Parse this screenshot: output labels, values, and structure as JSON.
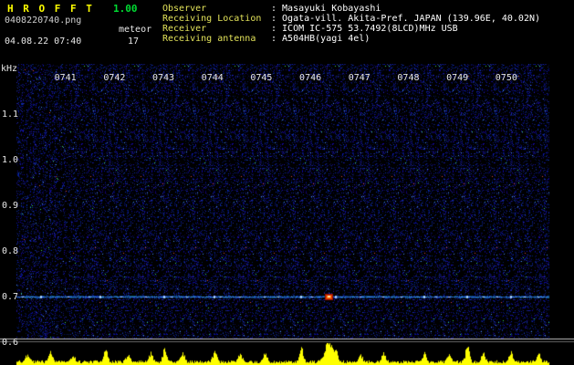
{
  "header": {
    "app_title": "H R O F F T",
    "version": "1.00",
    "filename": "0408220740.png",
    "mode_label": "meteor",
    "date_time": "04.08.22 07:40",
    "echo_count": "17",
    "info_rows": [
      {
        "label": "Observer",
        "value": ": Masayuki Kobayashi"
      },
      {
        "label": "Receiving Location",
        "value": ": Ogata-vill. Akita-Pref. JAPAN (139.96E, 40.02N)"
      },
      {
        "label": "Receiver",
        "value": ": ICOM IC-575 53.7492(8LCD)MHz USB"
      },
      {
        "label": "Receiving antenna",
        "value": ": A504HB(yagi 4el)"
      }
    ]
  },
  "chart_data": {
    "type": "heatmap",
    "title": "",
    "ylabel": "kHz",
    "x_ticks": [
      "0741",
      "0742",
      "0743",
      "0744",
      "0745",
      "0746",
      "0747",
      "0748",
      "0749",
      "0750"
    ],
    "y_ticks": [
      "1.1",
      "1.0",
      "0.9",
      "0.8",
      "0.7",
      "0.6"
    ],
    "x_range_min": [
      0,
      10.86
    ],
    "y_range_khz": [
      0.6,
      1.21
    ],
    "carrier_band_khz": 0.7,
    "grid": false,
    "echoes": [
      {
        "t_min": 0.13,
        "intensity": 0.5
      },
      {
        "t_min": 0.5,
        "intensity": 0.6
      },
      {
        "t_min": 1.06,
        "intensity": 0.5
      },
      {
        "t_min": 1.49,
        "intensity": 0.4
      },
      {
        "t_min": 1.71,
        "intensity": 0.6
      },
      {
        "t_min": 2.14,
        "intensity": 0.5
      },
      {
        "t_min": 2.64,
        "intensity": 0.45
      },
      {
        "t_min": 3.02,
        "intensity": 0.7
      },
      {
        "t_min": 3.17,
        "intensity": 0.5
      },
      {
        "t_min": 3.48,
        "intensity": 0.4
      },
      {
        "t_min": 4.04,
        "intensity": 0.65
      },
      {
        "t_min": 4.17,
        "intensity": 0.5
      },
      {
        "t_min": 4.56,
        "intensity": 0.45
      },
      {
        "t_min": 5.07,
        "intensity": 0.55
      },
      {
        "t_min": 5.34,
        "intensity": 0.4
      },
      {
        "t_min": 5.81,
        "intensity": 0.7
      },
      {
        "t_min": 6.03,
        "intensity": 0.5
      },
      {
        "t_min": 6.37,
        "intensity": 1.0,
        "strong": true
      },
      {
        "t_min": 6.52,
        "intensity": 0.6
      },
      {
        "t_min": 7.02,
        "intensity": 0.55
      },
      {
        "t_min": 7.49,
        "intensity": 0.5
      },
      {
        "t_min": 7.86,
        "intensity": 0.45
      },
      {
        "t_min": 8.32,
        "intensity": 0.6
      },
      {
        "t_min": 8.57,
        "intensity": 0.45
      },
      {
        "t_min": 8.83,
        "intensity": 0.5
      },
      {
        "t_min": 9.2,
        "intensity": 0.65
      },
      {
        "t_min": 9.53,
        "intensity": 0.5
      },
      {
        "t_min": 9.81,
        "intensity": 0.55
      },
      {
        "t_min": 10.09,
        "intensity": 0.7
      },
      {
        "t_min": 10.37,
        "intensity": 0.5
      },
      {
        "t_min": 10.65,
        "intensity": 0.45
      }
    ],
    "amplitude": {
      "noise_floor": 0.12,
      "peaks": [
        {
          "t_min": 0.22,
          "h": 0.35
        },
        {
          "t_min": 0.69,
          "h": 0.5
        },
        {
          "t_min": 1.15,
          "h": 0.32
        },
        {
          "t_min": 1.81,
          "h": 0.6
        },
        {
          "t_min": 2.27,
          "h": 0.33
        },
        {
          "t_min": 2.74,
          "h": 0.45
        },
        {
          "t_min": 3.02,
          "h": 0.6
        },
        {
          "t_min": 3.39,
          "h": 0.4
        },
        {
          "t_min": 4.04,
          "h": 0.55
        },
        {
          "t_min": 4.56,
          "h": 0.35
        },
        {
          "t_min": 5.07,
          "h": 0.4
        },
        {
          "t_min": 5.81,
          "h": 0.7
        },
        {
          "t_min": 6.37,
          "h": 1.05,
          "w": 0.1
        },
        {
          "t_min": 6.52,
          "h": 0.5
        },
        {
          "t_min": 7.02,
          "h": 0.35
        },
        {
          "t_min": 7.49,
          "h": 0.4
        },
        {
          "t_min": 8.32,
          "h": 0.45
        },
        {
          "t_min": 8.83,
          "h": 0.35
        },
        {
          "t_min": 9.2,
          "h": 0.8
        },
        {
          "t_min": 9.53,
          "h": 0.45
        },
        {
          "t_min": 10.09,
          "h": 0.5
        },
        {
          "t_min": 10.65,
          "h": 0.4
        }
      ]
    }
  },
  "colors": {
    "background": "#000000",
    "title_yellow": "#ffff00",
    "version_green": "#00dd33",
    "info_label_yellow": "#e3e35a",
    "text_white": "#ffffff",
    "text_dim": "#d0d0d0",
    "tick_text": "#e8e8e8",
    "noise_blue": "#3838c8",
    "carrier_band_blue": "#4d7fe6",
    "strong_echo_orange": "#ff7700",
    "amplitude_yellow": "#ffff00",
    "separator_gray": "#c0c0c0"
  }
}
